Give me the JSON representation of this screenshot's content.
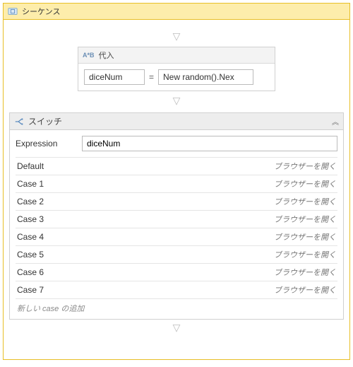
{
  "sequence": {
    "title": "シーケンス"
  },
  "assign": {
    "title": "代入",
    "to_value": "diceNum",
    "equals": "=",
    "value_value": "New random().Nex"
  },
  "switch": {
    "title": "スイッチ",
    "expression_label": "Expression",
    "expression_value": "diceNum",
    "cases": [
      {
        "label": "Default",
        "action": "ブラウザーを開く"
      },
      {
        "label": "Case 1",
        "action": "ブラウザーを開く"
      },
      {
        "label": "Case 2",
        "action": "ブラウザーを開く"
      },
      {
        "label": "Case 3",
        "action": "ブラウザーを開く"
      },
      {
        "label": "Case 4",
        "action": "ブラウザーを開く"
      },
      {
        "label": "Case 5",
        "action": "ブラウザーを開く"
      },
      {
        "label": "Case 6",
        "action": "ブラウザーを開く"
      },
      {
        "label": "Case 7",
        "action": "ブラウザーを開く"
      }
    ],
    "add_case_hint": "新しい case の追加"
  },
  "glyphs": {
    "flow_arrow": "▽",
    "collapse": "︽"
  }
}
